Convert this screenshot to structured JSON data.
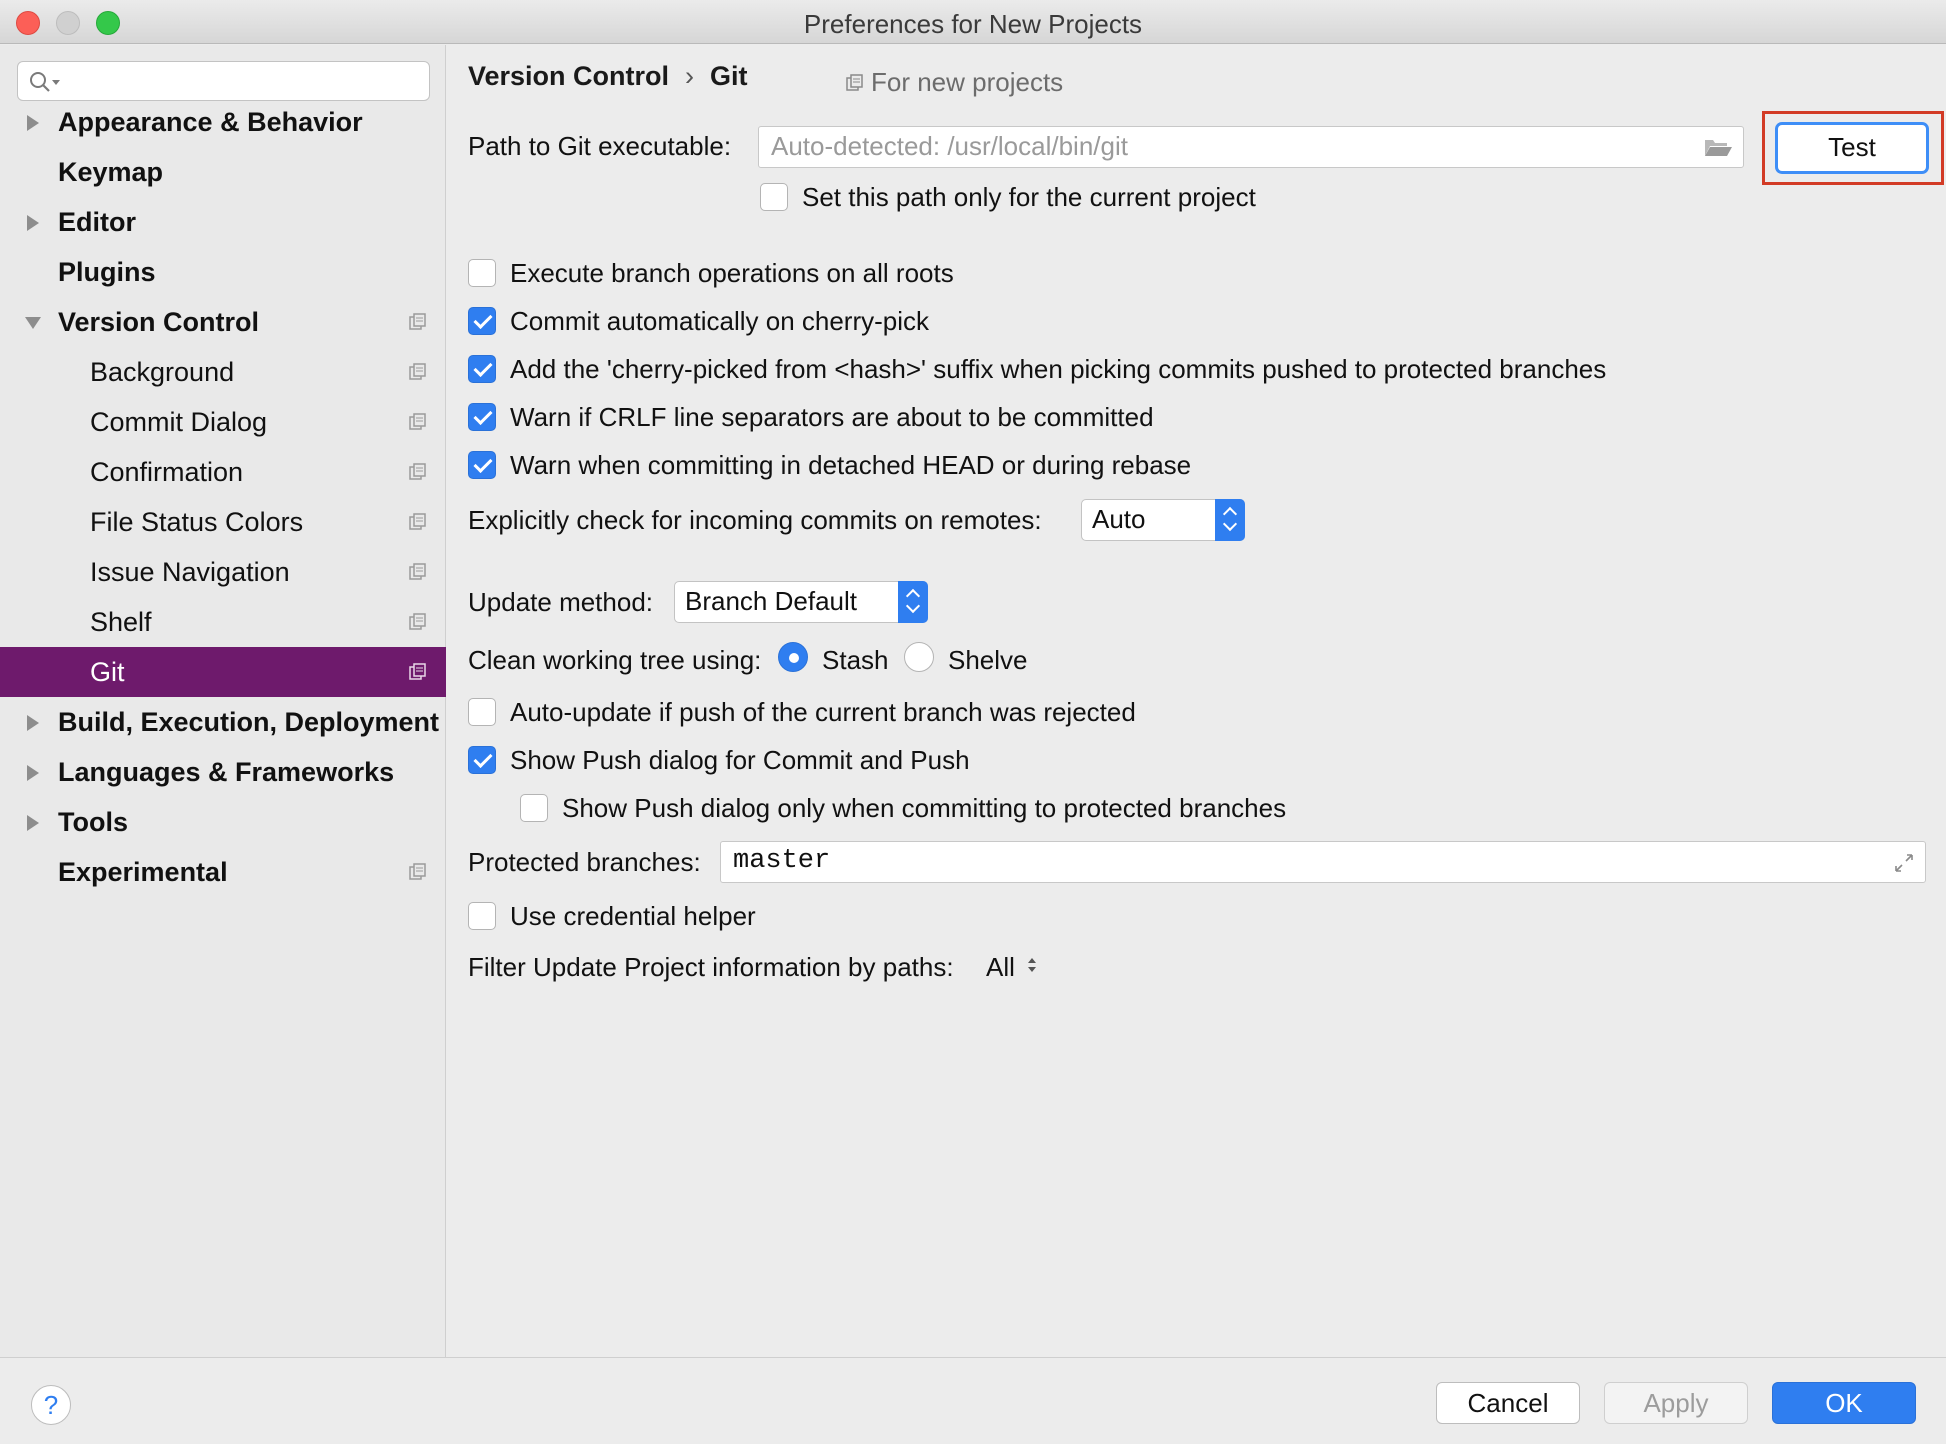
{
  "window": {
    "title": "Preferences for New Projects"
  },
  "search": {
    "placeholder": "",
    "value": ""
  },
  "sidebar": {
    "items": [
      {
        "label": "Appearance & Behavior"
      },
      {
        "label": "Keymap"
      },
      {
        "label": "Editor"
      },
      {
        "label": "Plugins"
      },
      {
        "label": "Version Control"
      },
      {
        "label": "Background"
      },
      {
        "label": "Commit Dialog"
      },
      {
        "label": "Confirmation"
      },
      {
        "label": "File Status Colors"
      },
      {
        "label": "Issue Navigation"
      },
      {
        "label": "Shelf"
      },
      {
        "label": "Git"
      },
      {
        "label": "Build, Execution, Deployment"
      },
      {
        "label": "Languages & Frameworks"
      },
      {
        "label": "Tools"
      },
      {
        "label": "Experimental"
      }
    ],
    "selected": "Git",
    "selected_color": "#6e1a6c"
  },
  "breadcrumb": {
    "parent": "Version Control",
    "separator": "›",
    "current": "Git",
    "scope": "For new projects"
  },
  "git_path": {
    "label": "Path to Git executable:",
    "placeholder": "Auto-detected: /usr/local/bin/git",
    "test_label": "Test",
    "current_project_only": "Set this path only for the current project"
  },
  "options": {
    "execute_all_roots": "Execute branch operations on all roots",
    "commit_cherry_pick": "Commit automatically on cherry-pick",
    "cherry_suffix": "Add the 'cherry-picked from <hash>' suffix when picking commits pushed to protected branches",
    "warn_crlf": "Warn if CRLF line separators are about to be committed",
    "warn_detached": "Warn when committing in detached HEAD or during rebase"
  },
  "incoming": {
    "label": "Explicitly check for incoming commits on remotes:",
    "value": "Auto"
  },
  "update_method": {
    "label": "Update method:",
    "value": "Branch Default"
  },
  "clean_tree": {
    "label": "Clean working tree using:",
    "stash": "Stash",
    "shelve": "Shelve",
    "selected": "Stash"
  },
  "push": {
    "auto_update": "Auto-update if push of the current branch was rejected",
    "show_push_dialog": "Show Push dialog for Commit and Push",
    "show_push_protected": "Show Push dialog only when committing to protected branches"
  },
  "protected": {
    "label": "Protected branches:",
    "value": "master"
  },
  "credential": {
    "label": "Use credential helper"
  },
  "filter": {
    "label": "Filter Update Project information by paths:",
    "value": "All"
  },
  "footer": {
    "help": "?",
    "cancel": "Cancel",
    "apply": "Apply",
    "ok": "OK"
  },
  "colors": {
    "accent": "#2f7ef0",
    "highlight": "#d23b26"
  }
}
